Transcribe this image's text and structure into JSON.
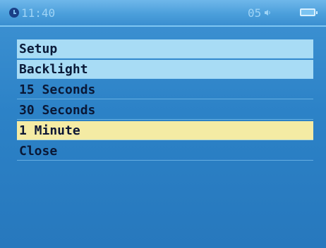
{
  "status_bar": {
    "time": "11:40",
    "volume": "05",
    "clock_icon": "clock-icon",
    "speaker_icon": "speaker-icon",
    "battery_icon": "battery-icon"
  },
  "menu": {
    "items": [
      {
        "label": "Setup",
        "style": "header"
      },
      {
        "label": "Backlight",
        "style": "header"
      },
      {
        "label": "15 Seconds",
        "style": "plain"
      },
      {
        "label": "30 Seconds",
        "style": "plain"
      },
      {
        "label": "1 Minute",
        "style": "selected"
      },
      {
        "label": "Close",
        "style": "plain"
      }
    ]
  },
  "colors": {
    "background": "#2c82c7",
    "header_item": "#a8dcf5",
    "selected_item": "#f4eba4",
    "status_text": "#9fd4f6"
  }
}
